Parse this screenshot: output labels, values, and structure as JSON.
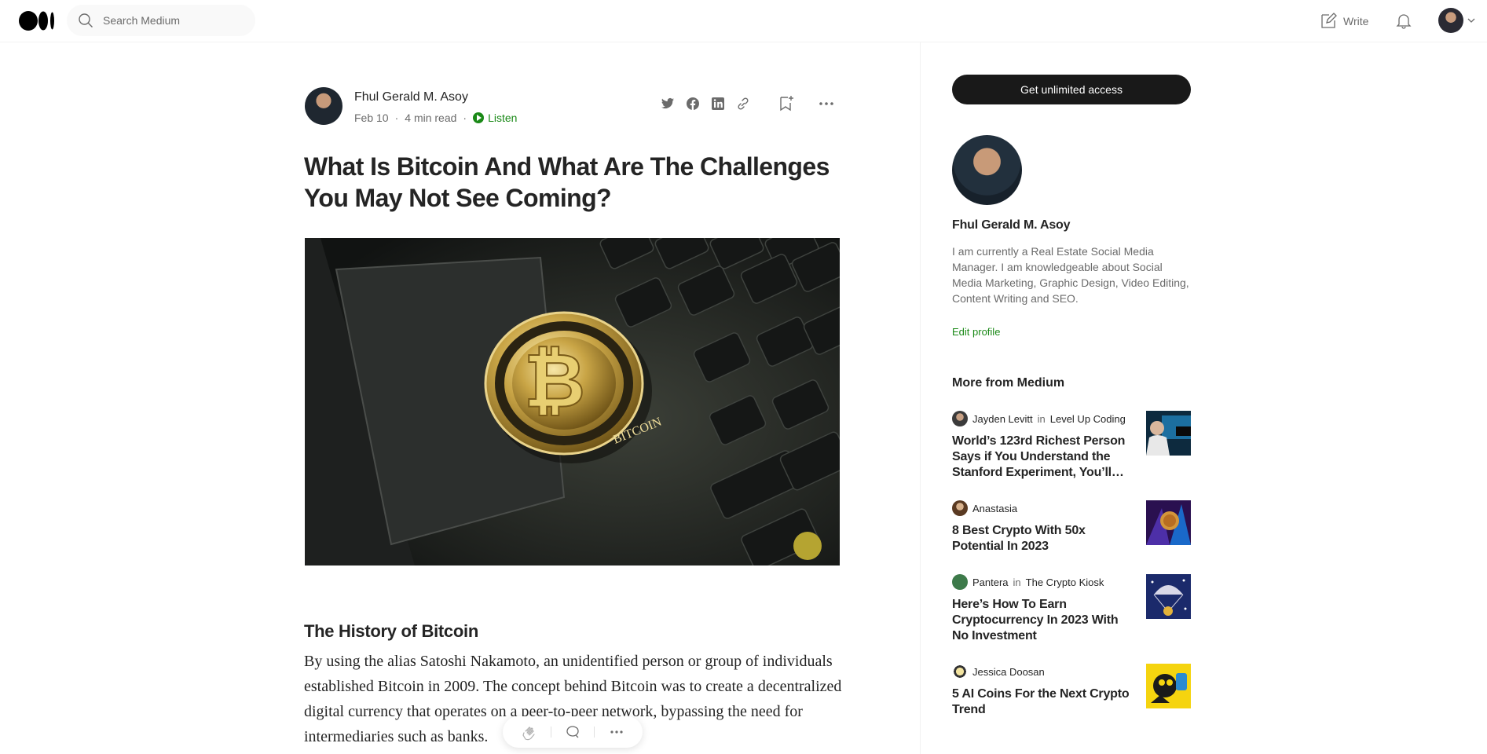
{
  "topbar": {
    "search_placeholder": "Search Medium",
    "write_label": "Write"
  },
  "article": {
    "author": "Fhul Gerald M. Asoy",
    "date": "Feb 10",
    "read_time": "4 min read",
    "listen_label": "Listen",
    "title": "What Is Bitcoin And What Are The Challenges You May Not See Coming?",
    "hero_alt": "Gold bitcoin coin resting on a laptop keyboard",
    "hero_coin_text": "BITCOIN",
    "section_heading": "The History of Bitcoin",
    "paragraph": "By using the alias Satoshi Nakamoto, an unidentified person or group of individuals established Bitcoin in 2009. The concept behind Bitcoin was to create a decentralized digital currency that operates on a peer-to-peer network, bypassing the need for intermediaries such as banks."
  },
  "sidebar": {
    "cta_label": "Get unlimited access",
    "author_name": "Fhul Gerald M. Asoy",
    "author_bio": "I am currently a Real Estate Social Media Manager. I am knowledgeable about Social Media Marketing, Graphic Design, Video Editing, Content Writing and SEO.",
    "edit_profile": "Edit profile",
    "more_title": "More from Medium",
    "recommendations": [
      {
        "author": "Jayden Levitt",
        "in": "in",
        "publication": "Level Up Coding",
        "title": "World’s 123rd Richest Person Says if You Understand the Stanford Experiment, You’ll…"
      },
      {
        "author": "Anastasia",
        "in": "",
        "publication": "",
        "title": "8 Best Crypto With 50x Potential In 2023"
      },
      {
        "author": "Pantera",
        "in": "in",
        "publication": "The Crypto Kiosk",
        "title": "Here’s How To Earn Cryptocurrency In 2023 With No Investment"
      },
      {
        "author": "Jessica Doosan",
        "in": "",
        "publication": "",
        "title": "5 AI Coins For the Next Crypto Trend"
      }
    ]
  },
  "colors": {
    "accent_green": "#1a8917",
    "text_primary": "#242424",
    "text_secondary": "#6b6b6b",
    "cta_background": "#191919"
  },
  "icons": [
    "medium-logo-icon",
    "search-icon",
    "write-icon",
    "bell-icon",
    "avatar",
    "chevron-down-icon",
    "twitter-icon",
    "facebook-icon",
    "linkedin-icon",
    "link-icon",
    "bookmark-add-icon",
    "more-icon",
    "play-icon",
    "clap-icon",
    "comment-icon"
  ]
}
